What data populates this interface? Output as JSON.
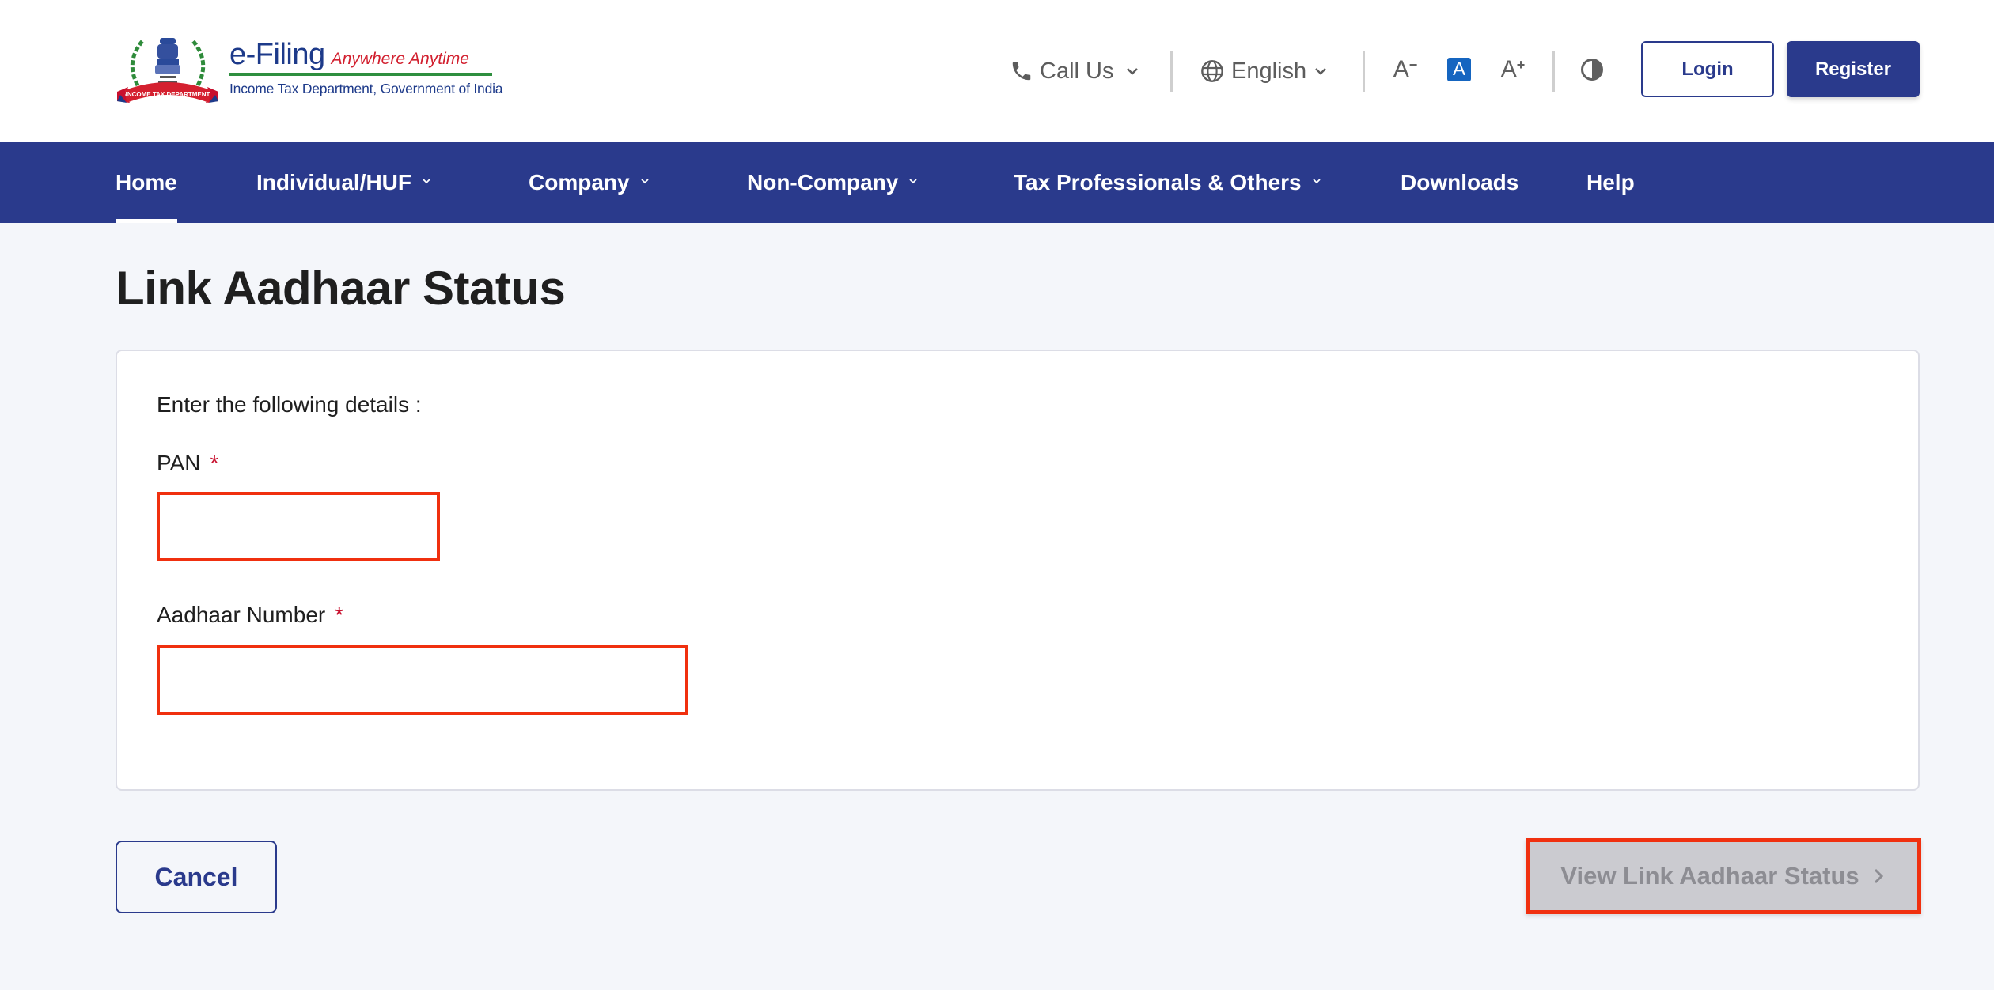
{
  "header": {
    "logo": {
      "title": "e-Filing",
      "tagline": "Anywhere Anytime",
      "subtitle": "Income Tax Department, Government of India",
      "ribbon_text": "INCOME TAX DEPARTMENT"
    },
    "utilities": {
      "call_us": {
        "label": "Call Us",
        "icon": "phone-icon"
      },
      "language": {
        "label": "English",
        "icon": "globe-icon"
      },
      "font_decrease": "A",
      "font_default": "A",
      "font_increase": "A",
      "contrast_icon": "contrast-icon"
    },
    "login_label": "Login",
    "register_label": "Register"
  },
  "nav": {
    "items": [
      {
        "label": "Home",
        "has_dropdown": false,
        "active": true
      },
      {
        "label": "Individual/HUF",
        "has_dropdown": true
      },
      {
        "label": "Company",
        "has_dropdown": true
      },
      {
        "label": "Non-Company",
        "has_dropdown": true
      },
      {
        "label": "Tax Professionals & Others",
        "has_dropdown": true
      },
      {
        "label": "Downloads",
        "has_dropdown": false
      },
      {
        "label": "Help",
        "has_dropdown": false
      }
    ]
  },
  "main": {
    "title": "Link Aadhaar Status",
    "form": {
      "intro": "Enter the following details :",
      "fields": [
        {
          "label": "PAN",
          "required_marker": "*",
          "value": "",
          "placeholder": ""
        },
        {
          "label": "Aadhaar Number",
          "required_marker": "*",
          "value": "",
          "placeholder": ""
        }
      ]
    },
    "cancel_label": "Cancel",
    "submit_label": "View Link Aadhaar Status",
    "submit_icon": "chevron-right-icon"
  },
  "colors": {
    "brand_navy": "#2a3a8c",
    "highlight_red": "#f0300f",
    "required_red": "#c8102e",
    "page_bg": "#f4f6fa",
    "disabled_bg": "#cbcbd0"
  }
}
